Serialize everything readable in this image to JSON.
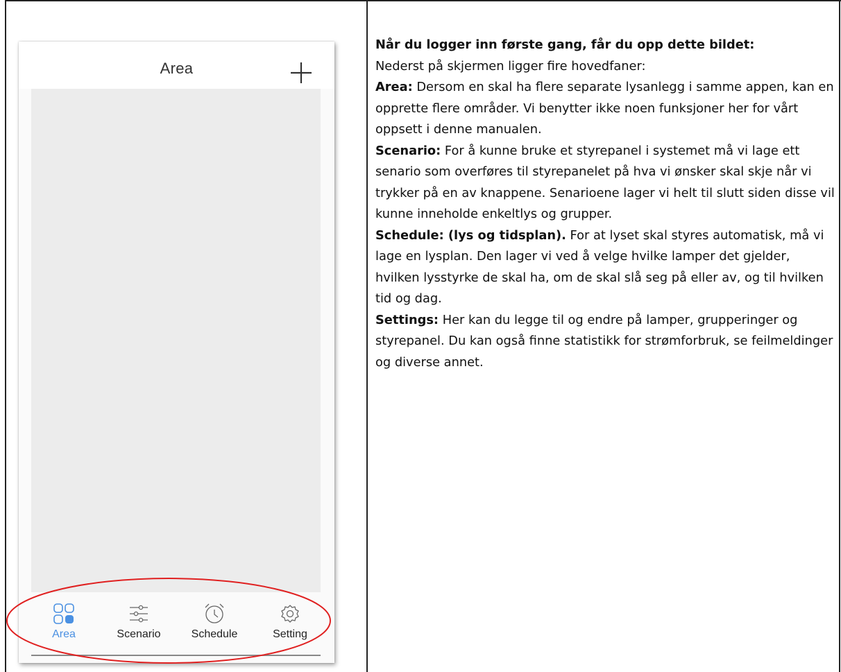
{
  "phone": {
    "title": "Area",
    "add_icon": "plus-icon",
    "tabs": [
      {
        "label": "Area",
        "icon": "area-grid-icon",
        "active": true
      },
      {
        "label": "Scenario",
        "icon": "sliders-icon",
        "active": false
      },
      {
        "label": "Schedule",
        "icon": "alarm-clock-icon",
        "active": false
      },
      {
        "label": "Setting",
        "icon": "gear-icon",
        "active": false
      }
    ],
    "accent_color": "#4a90e2",
    "annotation_color": "#e02020"
  },
  "doc": {
    "heading": "Når du logger inn første gang, får du opp dette bildet:",
    "intro": "Nederst på skjermen ligger fire hovedfaner:",
    "sections": [
      {
        "term": "Area:",
        "text": " Dersom en skal ha flere separate lysanlegg i samme appen, kan en opprette flere områder. Vi benytter ikke noen funksjoner her for vårt oppsett i denne manualen."
      },
      {
        "term": "Scenario:",
        "text": " For å kunne bruke et styrepanel i systemet må vi lage ett senario som overføres til styrepanelet på hva vi ønsker skal skje når vi trykker på en av knappene. Senarioene lager vi helt til slutt siden disse vil kunne inneholde enkeltlys og grupper."
      },
      {
        "term": "Schedule: (lys og tidsplan).",
        "text": " For at lyset skal styres automatisk, må vi lage en lysplan. Den lager vi ved å velge hvilke lamper det gjelder, hvilken lysstyrke de skal ha, om de skal slå seg på eller av, og til hvilken tid og dag."
      },
      {
        "term": "Settings:",
        "text": " Her kan du legge til og endre på lamper, grupperinger og styrepanel. Du kan også finne statistikk for strømforbruk, se feilmeldinger og diverse annet."
      }
    ]
  }
}
